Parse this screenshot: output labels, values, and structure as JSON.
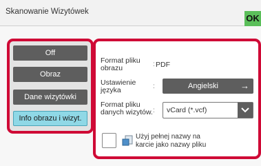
{
  "header": {
    "title": "Skanowanie Wizytówek",
    "ok_label": "OK"
  },
  "mode_buttons": [
    {
      "label": "Off",
      "selected": false
    },
    {
      "label": "Obraz",
      "selected": false
    },
    {
      "label": "Dane wizytówki",
      "selected": false
    },
    {
      "label": "Info obrazu i wizyt.",
      "selected": true
    }
  ],
  "settings": {
    "format_image": {
      "label_line1": "Format pliku",
      "label_line2": "obrazu",
      "colon": ":",
      "value": "PDF"
    },
    "language": {
      "label_line1": "Ustawienie",
      "label_line2": "języka",
      "colon": ":",
      "value": "Angielski"
    },
    "format_data": {
      "label_line1": "Format pliku",
      "label_line2": "danych wizytów.",
      "colon": ":",
      "value": "vCard (*.vcf)"
    }
  },
  "use_full_name": {
    "line1": "Użyj pełnej nazwy na",
    "line2": "karcie jako nazwy pliku",
    "checked": false
  },
  "colors": {
    "highlight": "#cf0a36",
    "ok_button": "#5bbf5a",
    "selected_button": "#8fd8e6",
    "button_dark": "#5e5e5e"
  }
}
